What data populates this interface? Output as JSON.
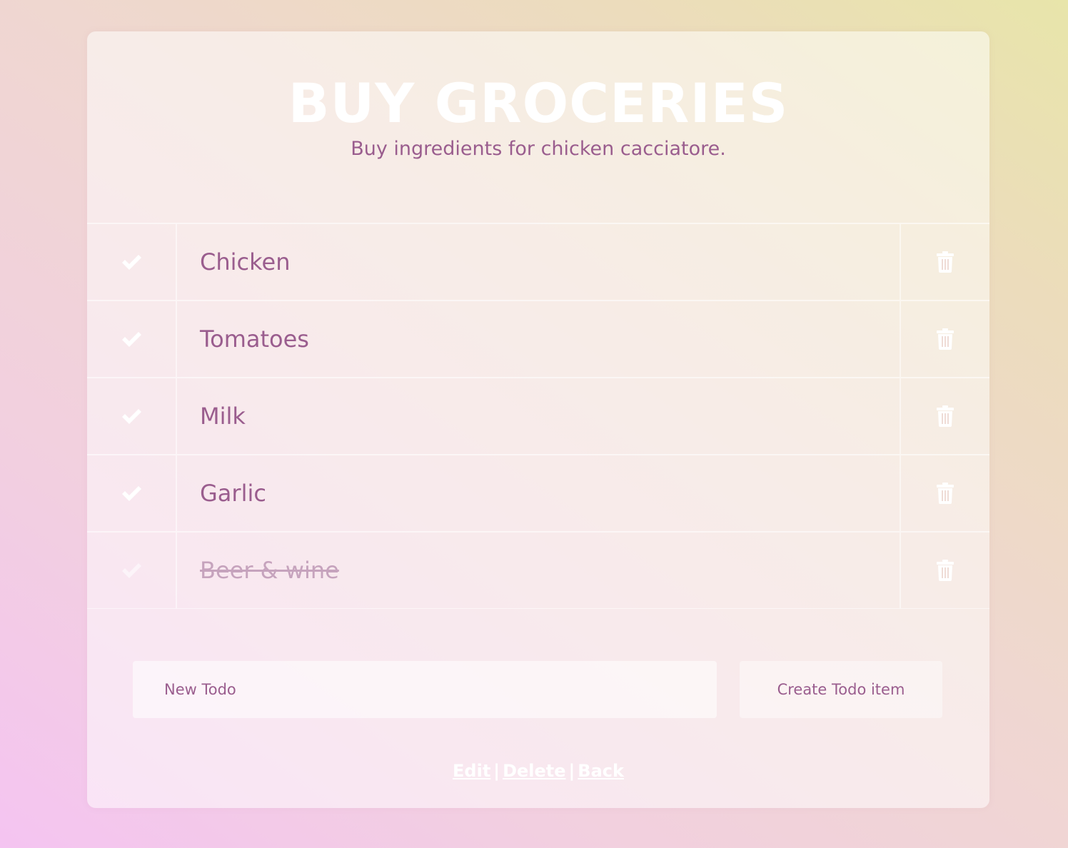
{
  "list": {
    "title": "BUY GROCERIES",
    "description": "Buy ingredients for chicken cacciatore."
  },
  "todos": [
    {
      "label": "Chicken",
      "completed": false
    },
    {
      "label": "Tomatoes",
      "completed": false
    },
    {
      "label": "Milk",
      "completed": false
    },
    {
      "label": "Garlic",
      "completed": false
    },
    {
      "label": "Beer & wine",
      "completed": true
    }
  ],
  "icons": {
    "check": "check-icon",
    "delete": "trash-icon"
  },
  "form": {
    "placeholder": "New Todo",
    "value": "",
    "submit_label": "Create Todo item"
  },
  "footer": {
    "edit_label": "Edit",
    "delete_label": "Delete",
    "back_label": "Back",
    "separator": "|"
  },
  "colors": {
    "accent_text": "#9a5d8e",
    "icon": "#ffffff",
    "completed_text": "#c6a3bd"
  }
}
